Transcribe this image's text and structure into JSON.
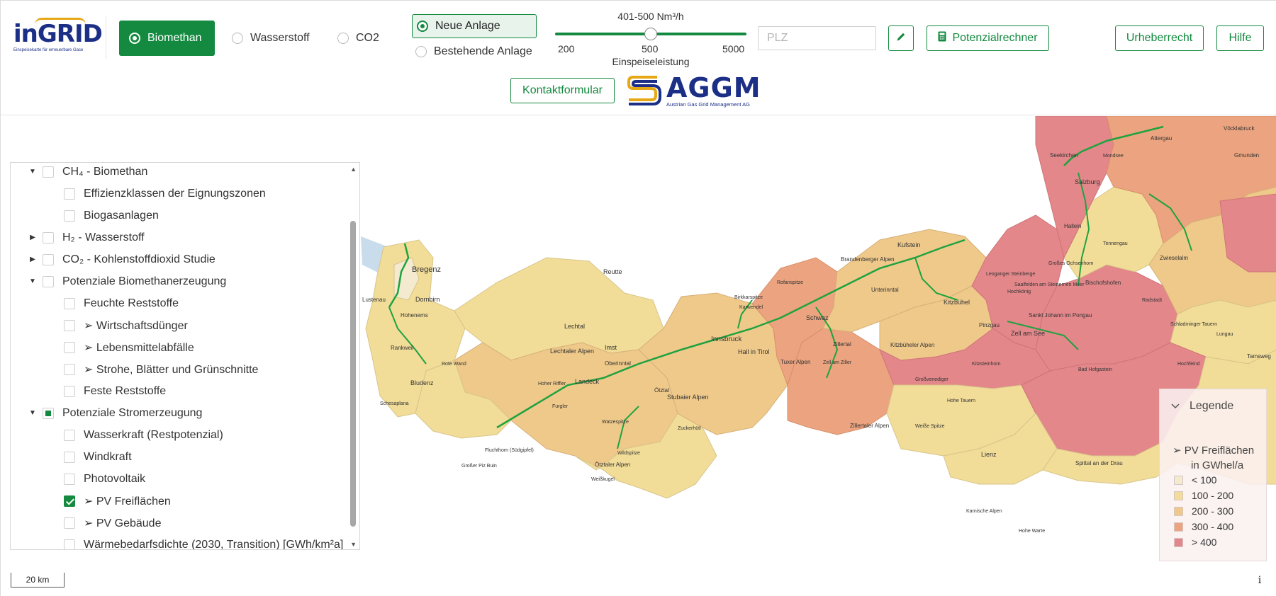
{
  "brand": {
    "logo_text": "inGRID",
    "logo_tagline": "Einspeisekarte für erneuerbare Gase"
  },
  "gas_type": {
    "options": [
      {
        "label": "Biomethan",
        "selected": true
      },
      {
        "label": "Wasserstoff",
        "selected": false
      },
      {
        "label": "CO2",
        "selected": false
      }
    ]
  },
  "anlage": {
    "options": [
      {
        "label": "Neue Anlage",
        "selected": true
      },
      {
        "label": "Bestehende Anlage",
        "selected": false
      }
    ]
  },
  "slider": {
    "value_label": "401-500 Nm³/h",
    "ticks": [
      "200",
      "500",
      "5000"
    ],
    "caption": "Einspeiseleistung",
    "position_fraction": 0.5
  },
  "search": {
    "plz_placeholder": "PLZ"
  },
  "toolbar": {
    "pencil_icon": "pencil-icon",
    "calculator_icon": "calculator-icon",
    "potenzialrechner_label": "Potenzialrechner",
    "urheberrecht_label": "Urheberrecht",
    "hilfe_label": "Hilfe",
    "kontakt_label": "Kontaktformular"
  },
  "partner": {
    "logo_text": "AGGM",
    "logo_tagline": "Austrian Gas Grid Management AG"
  },
  "layers": [
    {
      "label": "CH₄ - Biomethan",
      "level": 0,
      "expanded": true,
      "state": "unchecked"
    },
    {
      "label": "Effizienzklassen der Eignungszonen",
      "level": 1,
      "state": "unchecked"
    },
    {
      "label": "Biogasanlagen",
      "level": 1,
      "state": "unchecked"
    },
    {
      "label": "H₂ - Wasserstoff",
      "level": 0,
      "expanded": false,
      "state": "unchecked"
    },
    {
      "label": "CO₂ - Kohlenstoffdioxid Studie",
      "level": 0,
      "expanded": false,
      "state": "unchecked"
    },
    {
      "label": "Potenziale Biomethanerzeugung",
      "level": 0,
      "expanded": true,
      "state": "unchecked"
    },
    {
      "label": "Feuchte Reststoffe",
      "level": 1,
      "state": "unchecked"
    },
    {
      "label": "➢ Wirtschaftsdünger",
      "level": 1,
      "state": "unchecked"
    },
    {
      "label": "➢ Lebensmittelabfälle",
      "level": 1,
      "state": "unchecked"
    },
    {
      "label": "➢ Strohe, Blätter und Grünschnitte",
      "level": 1,
      "state": "unchecked"
    },
    {
      "label": "Feste Reststoffe",
      "level": 1,
      "state": "unchecked"
    },
    {
      "label": "Potenziale Stromerzeugung",
      "level": 0,
      "expanded": true,
      "state": "partial"
    },
    {
      "label": "Wasserkraft (Restpotenzial)",
      "level": 1,
      "state": "unchecked"
    },
    {
      "label": "Windkraft",
      "level": 1,
      "state": "unchecked"
    },
    {
      "label": "Photovoltaik",
      "level": 1,
      "state": "unchecked"
    },
    {
      "label": "➢ PV Freiflächen",
      "level": 1,
      "state": "checked"
    },
    {
      "label": "➢ PV Gebäude",
      "level": 1,
      "state": "unchecked"
    },
    {
      "label": "Wärmebedarfsdichte (2030, Transition) [GWh/km²a]",
      "level": 1,
      "state": "unchecked"
    }
  ],
  "legend": {
    "header": "Legende",
    "title_line1": "➢ PV Freiflächen",
    "title_line2": "in GWhel/a",
    "classes": [
      {
        "label": "< 100",
        "color": "#f3ead0"
      },
      {
        "label": "100 - 200",
        "color": "#f1dc98"
      },
      {
        "label": "200 - 300",
        "color": "#efc98a"
      },
      {
        "label": "300 - 400",
        "color": "#eba47f"
      },
      {
        "label": "> 400",
        "color": "#e3878a"
      }
    ]
  },
  "map": {
    "scale_label": "20 km",
    "info_label": "i",
    "colors": {
      "class1": "#f3ead0",
      "class2": "#f1dc98",
      "class3": "#efc98a",
      "class4": "#eba47f",
      "class5": "#e3878a",
      "pipeline": "#1fa23f",
      "lake": "#c8dcec"
    },
    "place_labels": [
      "Bregenz",
      "Dornbirn",
      "Lustenau",
      "Hohenems",
      "Rankweil",
      "Bludenz",
      "Rote Wand",
      "Schesaplana",
      "Reutte",
      "Lechtal",
      "Lechtaler Alpen",
      "Imst",
      "Landeck",
      "Oberinntal",
      "Ötztal",
      "Hoher Riffler",
      "Furgler",
      "Watzespitze",
      "Wildspitze",
      "Ötztaler Alpen",
      "Weißkugel",
      "Fluchthorn (Südgipfel)",
      "Großer Piz Buin",
      "Innsbruck",
      "Hall in Tirol",
      "Stubaier Alpen",
      "Zuckerhütl",
      "Schwaz",
      "Zillertal",
      "Tuxer Alpen",
      "Zell am Ziller",
      "Zillertaler Alpen",
      "Kufstein",
      "Unterinntal",
      "Kitzbühel",
      "Kitzbüheler Alpen",
      "Brandenberger Alpen",
      "Rofanspitze",
      "Karwendel",
      "Birkkarspitze",
      "Saalfelden am Steinernen Meer",
      "Leoganger Steinberge",
      "Zell am See",
      "Pinzgau",
      "Sankt Johann im Pongau",
      "Großvenediger",
      "Hohe Tauern",
      "Hochkönig",
      "Bischofshofen",
      "Radstadt",
      "Schladminger Tauern",
      "Lienz",
      "Spittal an der Drau",
      "Salzburg",
      "Seekirchen",
      "Hallein",
      "Tennengau",
      "Zwieselalm",
      "Attergau",
      "Gmunden",
      "Vöcklabruck",
      "Mondsee",
      "Bad Hofgastein",
      "Kitzsteinhorn",
      "Tamsweg",
      "Hochfeind",
      "Weiße Spitze",
      "Karnische Alpen",
      "Hohe Warte",
      "Lungau",
      "Großes Ochsenhorn"
    ]
  }
}
